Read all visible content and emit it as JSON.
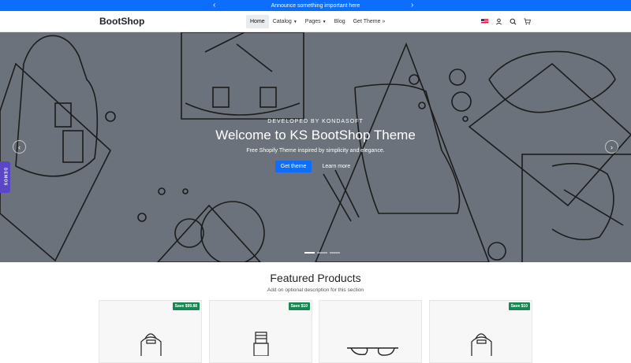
{
  "announcement": {
    "text": "Announce something important here",
    "prev_icon": "chevron-left-icon",
    "next_icon": "chevron-right-icon"
  },
  "navbar": {
    "brand": "BootShop",
    "items": [
      {
        "label": "Home",
        "active": true
      },
      {
        "label": "Catalog",
        "dropdown": true
      },
      {
        "label": "Pages",
        "dropdown": true
      },
      {
        "label": "Blog"
      },
      {
        "label": "Get Theme »"
      }
    ],
    "icons": [
      "us-flag-icon",
      "user-icon",
      "search-icon",
      "cart-icon"
    ]
  },
  "hero": {
    "kicker": "DEVELOPED BY KONDASOFT",
    "title": "Welcome to KS BootShop Theme",
    "subtitle": "Free Shopify Theme inspired by simplicity and elegance.",
    "primary_button": "Get theme",
    "secondary_button": "Learn more",
    "slides": 3,
    "active_slide": 1
  },
  "demos_tab": "DEMOS",
  "featured": {
    "title": "Featured Products",
    "description": "Add on optional description for this section",
    "products": [
      {
        "badge": "Save $99.88",
        "image": "backpack-icon"
      },
      {
        "badge": "Save $10",
        "image": "wristwatch-icon"
      },
      {
        "badge": "",
        "image": "sunglasses-icon"
      },
      {
        "badge": "Save $10",
        "image": "backpack-icon"
      }
    ]
  },
  "colors": {
    "primary": "#0d6efd",
    "hero_bg": "#6c727b",
    "badge": "#198754",
    "demos": "#5b46c7"
  }
}
